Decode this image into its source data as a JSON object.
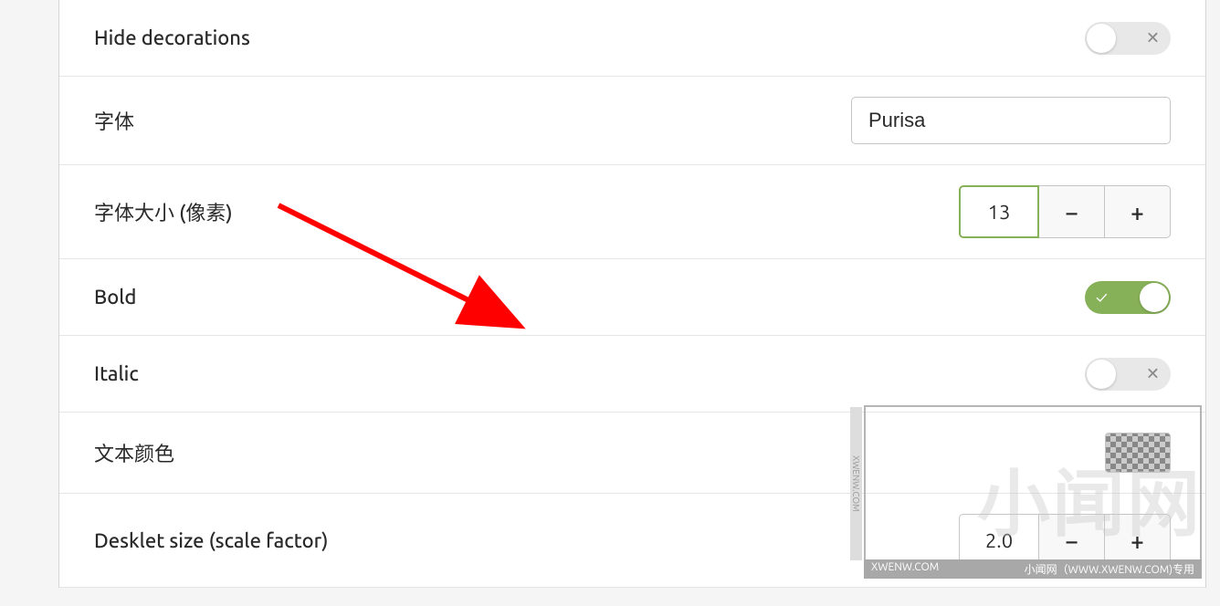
{
  "rows": {
    "hide_decorations": {
      "label": "Hide decorations",
      "state": "off"
    },
    "font": {
      "label": "字体",
      "value": "Purisa"
    },
    "font_size": {
      "label": "字体大小 (像素)",
      "value": "13"
    },
    "bold": {
      "label": "Bold",
      "state": "on"
    },
    "italic": {
      "label": "Italic",
      "state": "off"
    },
    "text_color": {
      "label": "文本颜色"
    },
    "desklet_size": {
      "label": "Desklet size (scale factor)",
      "value": "2.0"
    }
  },
  "watermark": {
    "main_text": "小闻网",
    "side_text": "XWENW.COM",
    "footer_left": "XWENW.COM",
    "footer_right": "小闻网（WWW.XWENW.COM)专用"
  }
}
